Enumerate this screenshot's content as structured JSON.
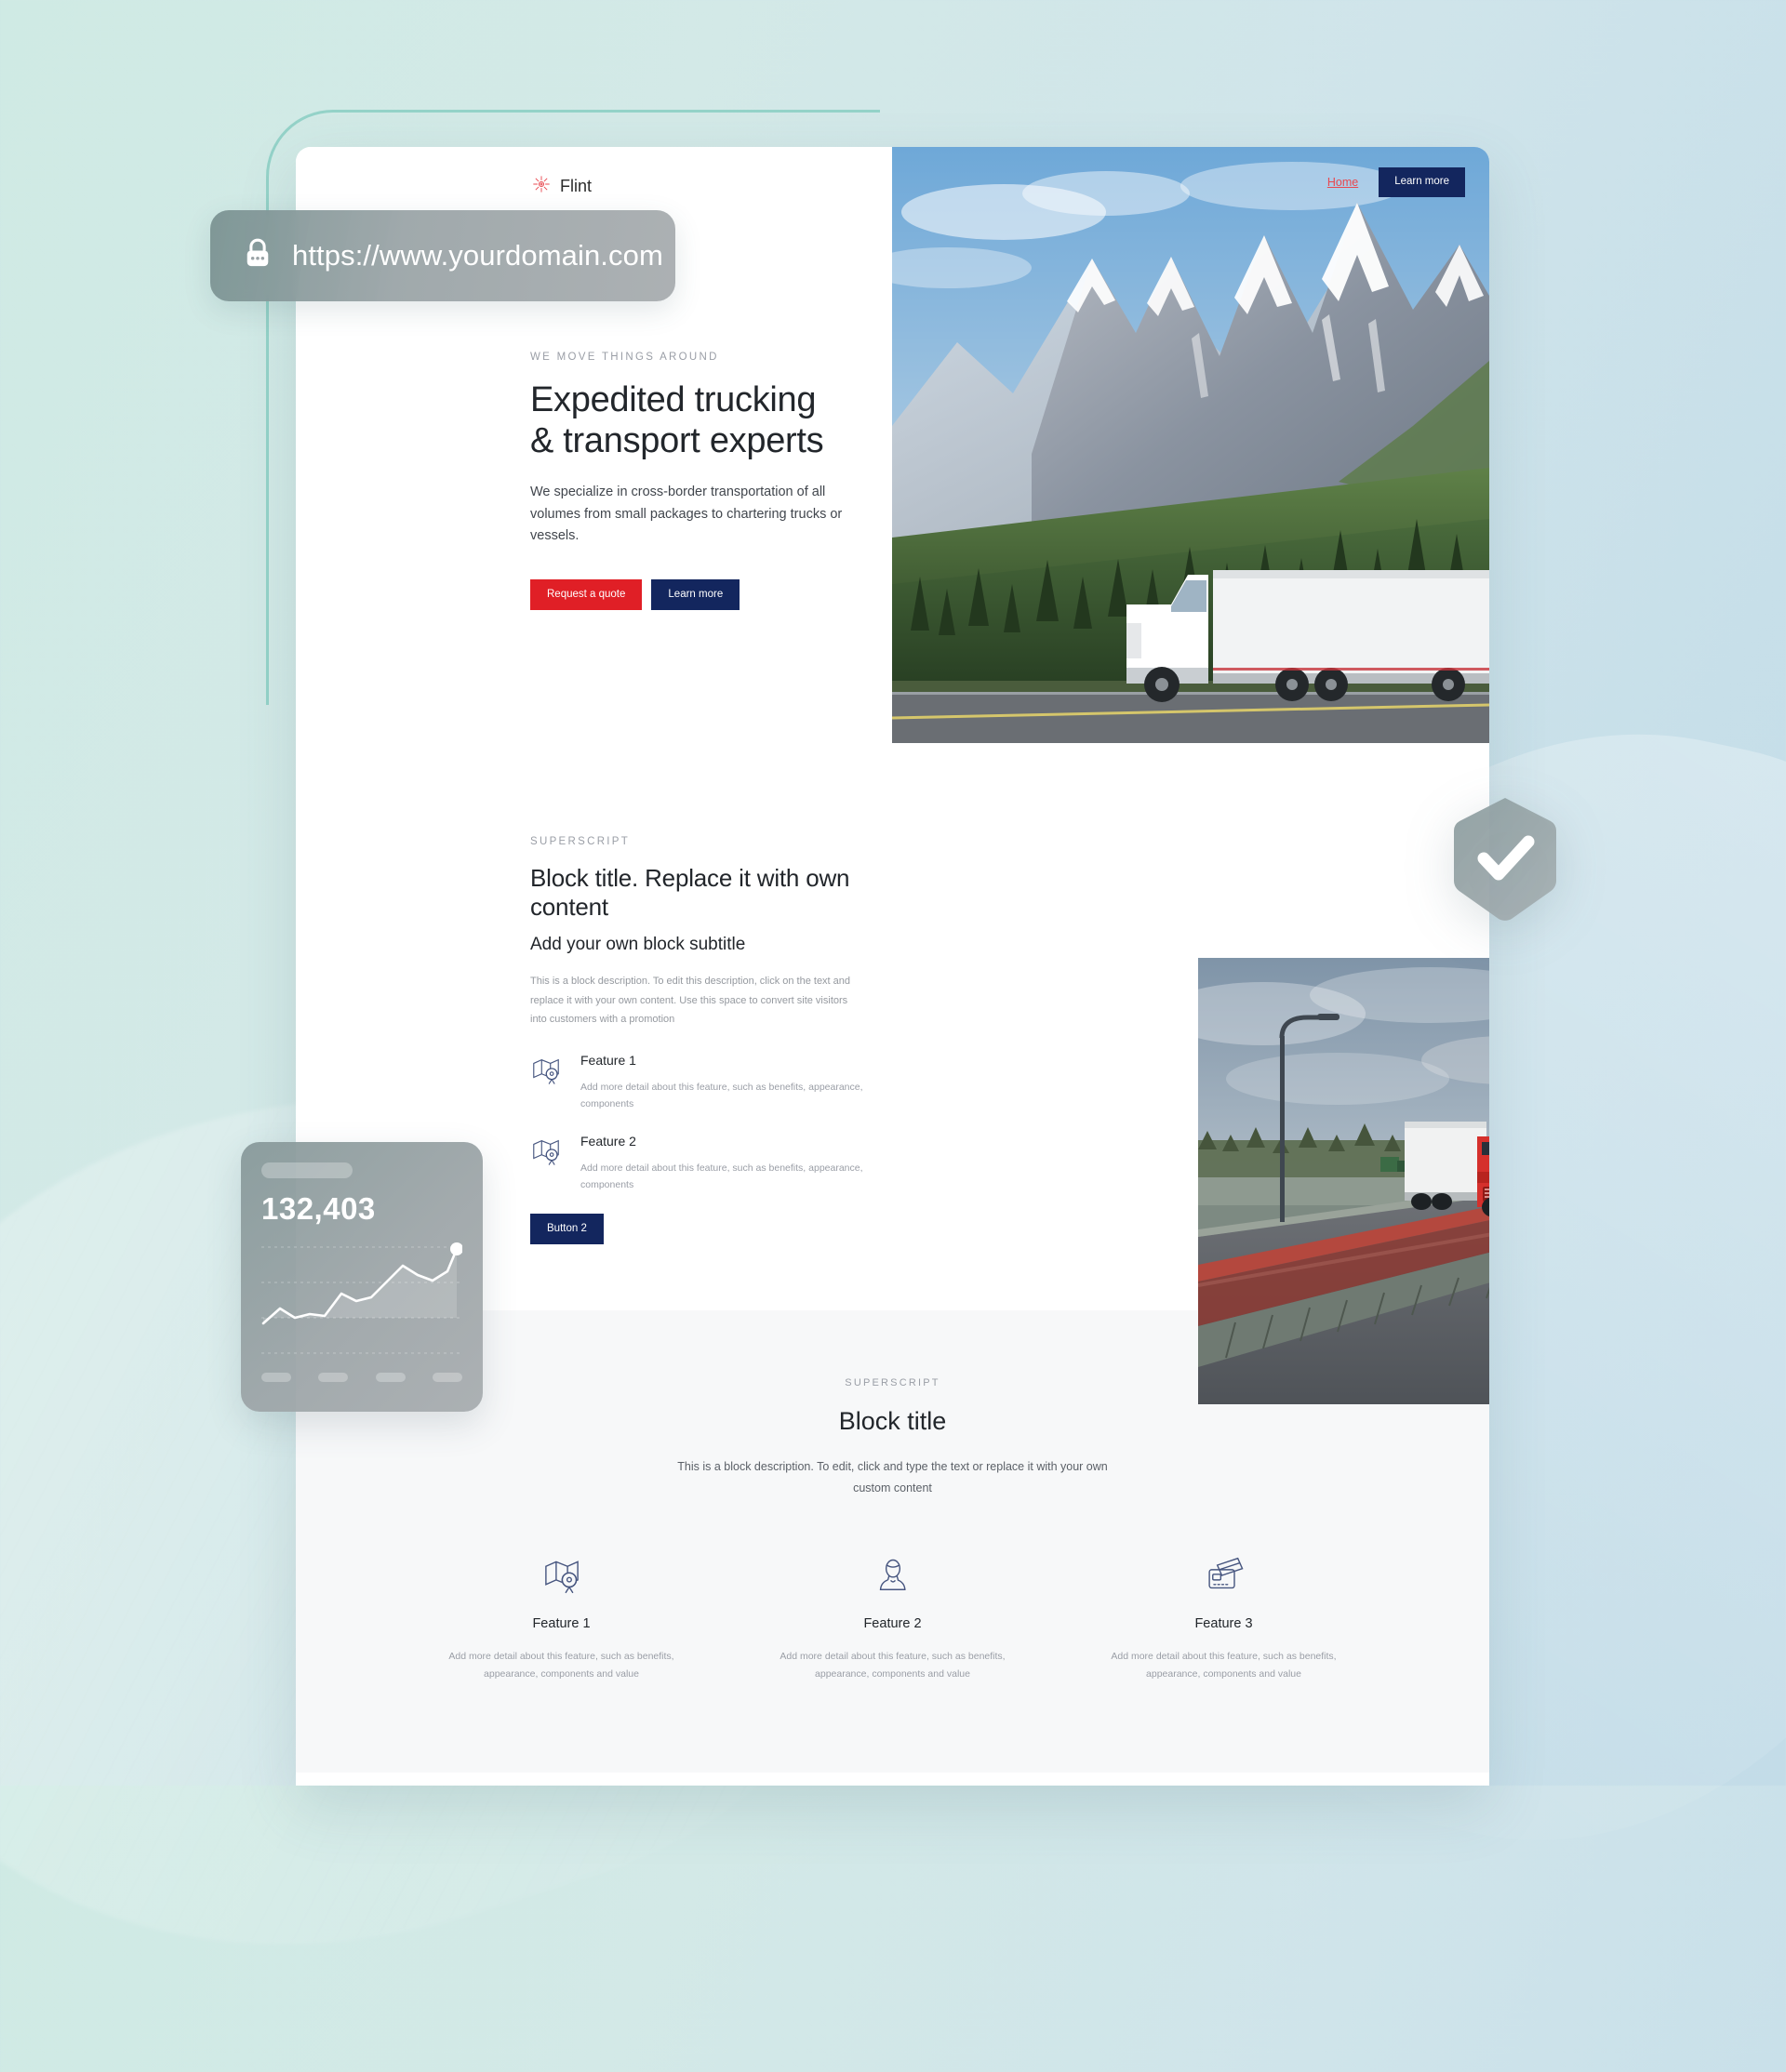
{
  "url_bar": {
    "icon": "lock-icon",
    "value": "https://www.yourdomain.com"
  },
  "site": {
    "brand": {
      "logo_icon": "starburst-icon",
      "name": "Flint"
    },
    "nav": {
      "home_label": "Home",
      "cta_label": "Learn more"
    },
    "hero": {
      "eyebrow": "WE MOVE THINGS AROUND",
      "title_line1": "Expedited trucking",
      "title_line2": "& transport experts",
      "subtitle": "We specialize in cross-border transportation of all volumes from small packages to chartering trucks or vessels.",
      "primary_button": "Request a quote",
      "secondary_button": "Learn more",
      "image_alt": "semi-truck-mountain-highway"
    },
    "block2": {
      "eyebrow": "SUPERSCRIPT",
      "title": "Block title. Replace it with own content",
      "subtitle": "Add your own block subtitle",
      "description": "This is a block description. To edit this description, click on the text and replace it with your own content. Use this space to convert site visitors into customers with a promotion",
      "features": [
        {
          "icon": "map-pin-icon",
          "title": "Feature 1",
          "text": "Add more detail about this feature, such as benefits, appearance, components"
        },
        {
          "icon": "map-pin-icon",
          "title": "Feature 2",
          "text": "Add more detail about this feature, such as benefits, appearance, components"
        }
      ],
      "button": "Button 2",
      "image_alt": "red-truck-on-bridge"
    },
    "features_section": {
      "eyebrow": "SUPERSCRIPT",
      "title": "Block title",
      "description": "This is a block description. To edit, click and type the text or replace it with your own custom content",
      "cards": [
        {
          "icon": "map-pin-icon",
          "title": "Feature 1",
          "text": "Add more detail about this feature, such as benefits, appearance, components and value"
        },
        {
          "icon": "person-icon",
          "title": "Feature 2",
          "text": "Add more detail about this feature, such as benefits, appearance, components and value"
        },
        {
          "icon": "cards-icon",
          "title": "Feature 3",
          "text": "Add more detail about this feature, such as benefits, appearance, components and value"
        }
      ]
    }
  },
  "stats_widget": {
    "value": "132,403",
    "chart_points": [
      12,
      30,
      22,
      26,
      24,
      44,
      36,
      40,
      58,
      72,
      62,
      58,
      66,
      88
    ],
    "bars": 4
  },
  "trust_badge": {
    "icon": "shield-check-icon"
  },
  "colors": {
    "brand_red": "#e01f26",
    "brand_navy": "#13265e",
    "nav_link_red": "#e8484f",
    "icon_navy": "#46557f",
    "bg_mint": "#cfeae4",
    "bg_blue": "#c3dce8",
    "accent_teal": "#94d2c8",
    "section_gray": "#f7f8f9"
  }
}
